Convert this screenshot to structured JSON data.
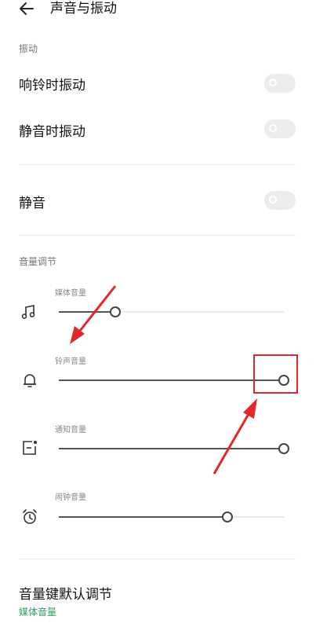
{
  "header": {
    "title": "声音与振动"
  },
  "vibration": {
    "section_label": "振动",
    "ring_vibrate": {
      "label": "响铃时振动",
      "on": false
    },
    "silent_vibrate": {
      "label": "静音时振动",
      "on": false
    }
  },
  "mute": {
    "label": "静音",
    "on": false
  },
  "volume": {
    "section_label": "音量调节",
    "media": {
      "label": "媒体音量",
      "level": 0.25,
      "icon": "music-note-icon"
    },
    "ringtone": {
      "label": "铃声音量",
      "level": 1.0,
      "icon": "bell-icon"
    },
    "notification": {
      "label": "通知音量",
      "level": 1.0,
      "icon": "notification-icon"
    },
    "alarm": {
      "label": "闹钟音量",
      "level": 0.75,
      "icon": "alarm-clock-icon"
    }
  },
  "volume_key": {
    "title": "音量键默认调节",
    "value": "媒体音量"
  },
  "colors": {
    "accent_green": "#2ca35f",
    "annotation_red": "#e0282a"
  }
}
